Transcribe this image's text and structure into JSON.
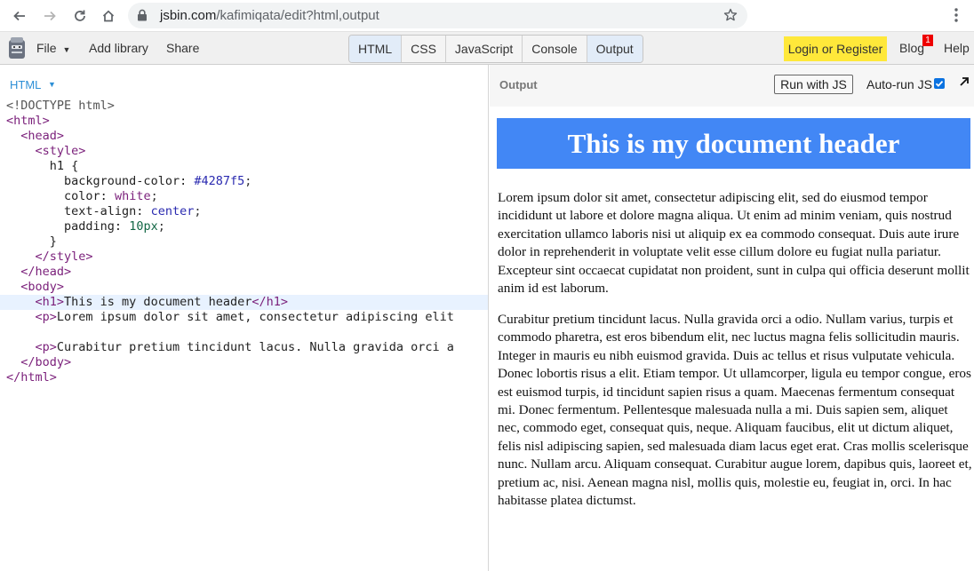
{
  "browser": {
    "url_host": "jsbin.com",
    "url_path": "/kafimiqata/edit?html,output",
    "icons": [
      "back-icon",
      "forward-icon",
      "reload-icon",
      "home-icon",
      "lock-icon",
      "star-icon",
      "kebab-menu-icon"
    ]
  },
  "toolbar": {
    "file_label": "File",
    "add_library_label": "Add library",
    "share_label": "Share",
    "panels": [
      {
        "label": "HTML",
        "active": true
      },
      {
        "label": "CSS",
        "active": false
      },
      {
        "label": "JavaScript",
        "active": false
      },
      {
        "label": "Console",
        "active": false
      },
      {
        "label": "Output",
        "active": true
      }
    ],
    "login_label": "Login or Register",
    "blog_label": "Blog",
    "blog_badge": "1",
    "help_label": "Help",
    "login_color": "#ffe83a",
    "badge_color": "#e00000"
  },
  "editor": {
    "language_label": "HTML",
    "lines": [
      "<!DOCTYPE html>",
      "<html>",
      "  <head>",
      "    <style>",
      "      h1 {",
      "        background-color: #4287f5;",
      "        color: white;",
      "        text-align: center;",
      "        padding: 10px;",
      "      }",
      "    </style>",
      "  </head>",
      "  <body>",
      "    <h1>This is my document header</h1>",
      "    <p>Lorem ipsum dolor sit amet, consectetur adipiscing elit",
      "",
      "    <p>Curabitur pretium tincidunt lacus. Nulla gravida orci a",
      "  </body>",
      "</html>"
    ],
    "highlighted_line": 13
  },
  "output": {
    "label": "Output",
    "run_label": "Run with JS",
    "autorun_label": "Auto-run JS",
    "autorun_checked": true,
    "document": {
      "header": "This is my document header",
      "header_bg": "#4287f5",
      "paragraph1": "Lorem ipsum dolor sit amet, consectetur adipiscing elit, sed do eiusmod tempor incididunt ut labore et dolore magna aliqua. Ut enim ad minim veniam, quis nostrud exercitation ullamco laboris nisi ut aliquip ex ea commodo consequat. Duis aute irure dolor in reprehenderit in voluptate velit esse cillum dolore eu fugiat nulla pariatur. Excepteur sint occaecat cupidatat non proident, sunt in culpa qui officia deserunt mollit anim id est laborum.",
      "paragraph2": "Curabitur pretium tincidunt lacus. Nulla gravida orci a odio. Nullam varius, turpis et commodo pharetra, est eros bibendum elit, nec luctus magna felis sollicitudin mauris. Integer in mauris eu nibh euismod gravida. Duis ac tellus et risus vulputate vehicula. Donec lobortis risus a elit. Etiam tempor. Ut ullamcorper, ligula eu tempor congue, eros est euismod turpis, id tincidunt sapien risus a quam. Maecenas fermentum consequat mi. Donec fermentum. Pellentesque malesuada nulla a mi. Duis sapien sem, aliquet nec, commodo eget, consequat quis, neque. Aliquam faucibus, elit ut dictum aliquet, felis nisl adipiscing sapien, sed malesuada diam lacus eget erat. Cras mollis scelerisque nunc. Nullam arcu. Aliquam consequat. Curabitur augue lorem, dapibus quis, laoreet et, pretium ac, nisi. Aenean magna nisl, mollis quis, molestie eu, feugiat in, orci. In hac habitasse platea dictumst."
    }
  }
}
